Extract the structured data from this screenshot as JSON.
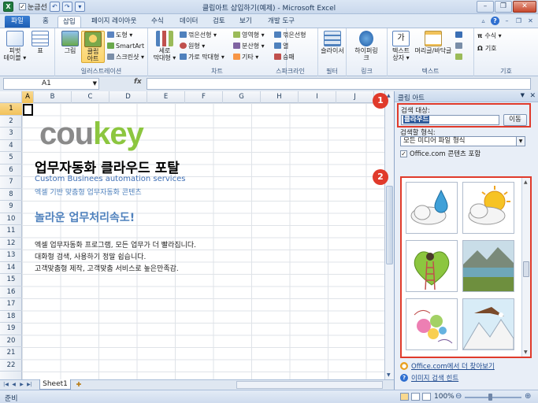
{
  "window": {
    "title": "클립아트 삽입하기(예제) - Microsoft Excel",
    "qat_check_label": "눈금선"
  },
  "tabs": [
    "파일",
    "홈",
    "삽입",
    "페이지 레이아웃",
    "수식",
    "데이터",
    "검토",
    "보기",
    "개발 도구"
  ],
  "ribbon": {
    "groups": [
      {
        "label": ""
      },
      {
        "label": "일러스트레이션"
      },
      {
        "label": "차트"
      },
      {
        "label": "스파크라인"
      },
      {
        "label": "필터"
      },
      {
        "label": "링크"
      },
      {
        "label": "텍스트"
      },
      {
        "label": "기호"
      }
    ],
    "pivot": "피벗\n테이블 ▾",
    "table": "표",
    "picture": "그림",
    "clipart": "클립\n아트",
    "shapes": "도형 ▾",
    "smartart": "SmartArt",
    "screenshot": "스크린샷 ▾",
    "column": "세로\n막대형 ▾",
    "line": "꺾은선형 ▾",
    "pie": "원형 ▾",
    "bar": "가로 막대형 ▾",
    "area": "영역형 ▾",
    "scatter": "분산형 ▾",
    "other": "기타 ▾",
    "spark_line": "꺾은선형",
    "spark_col": "열",
    "spark_win": "승패",
    "slicer": "슬라이서",
    "hyperlink": "하이퍼링크",
    "textbox": "텍스트\n상자 ▾",
    "header": "머리글/바닥글",
    "wordart": "",
    "equation": "수식 ▾",
    "symbol": "기호"
  },
  "formula": {
    "namebox": "A1",
    "fx": "fx",
    "value": ""
  },
  "columns": [
    "A",
    "B",
    "C",
    "D",
    "E",
    "F",
    "G",
    "H",
    "I",
    "J"
  ],
  "rows": [
    "1",
    "2",
    "3",
    "4",
    "5",
    "6",
    "7",
    "8",
    "9",
    "10",
    "11",
    "12",
    "13",
    "14",
    "15",
    "16",
    "17",
    "18",
    "19",
    "20",
    "21",
    "22"
  ],
  "sheet": {
    "logo_p1": "cou",
    "logo_p2": "key",
    "title": "업무자동화 클라우드 포탈",
    "subtitle_en": "Custom Businees automation services",
    "subtitle_ko": "엑셀 기반 맞춤형 업무자동화 콘텐츠",
    "headline": "놀라운 업무처리속도!",
    "line1": "엑셀 업무자동화 프로그램, 모든 업무가 더 빨라집니다.",
    "line2": "대화형 검색, 사용하기 정말 쉽습니다.",
    "line3": "고객맞춤형 제작, 고객맞춤 서비스로 높은만족감."
  },
  "sheet_tab": "Sheet1",
  "status": {
    "ready": "준비",
    "zoom": "100%",
    "zoom_level": 100
  },
  "taskpane": {
    "title": "클립 아트",
    "search_label": "검색 대상:",
    "search_value": "클라우드",
    "go_button": "이동",
    "result_label": "검색할 형식:",
    "result_value": "모든 미디어 파일 형식",
    "include_label": "Office.com 콘텐츠 포함",
    "more_link": "Office.com에서 더 찾아보기",
    "hint_link": "이미지 검색 힌트"
  },
  "badges": [
    "1",
    "2"
  ],
  "colors": {
    "accent_red": "#e03a2b",
    "logo_gray": "#8a8a8a",
    "logo_green": "#8cc63f",
    "link_blue": "#4f81bd"
  }
}
